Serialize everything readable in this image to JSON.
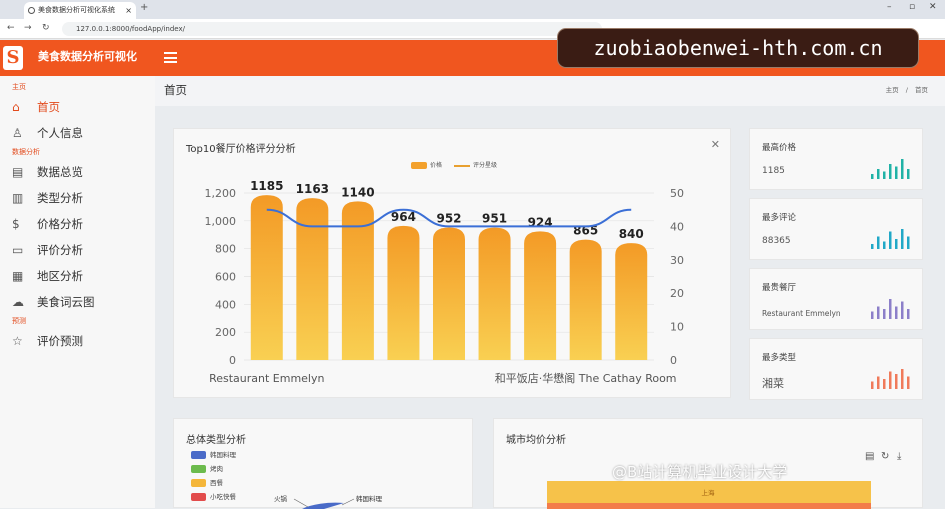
{
  "browser": {
    "tab_title": "美食数据分析可视化系统",
    "new_tab": "+",
    "url": "127.0.0.1:8000/foodApp/index/",
    "win_min": "–",
    "win_max": "▫",
    "win_close": "✕"
  },
  "header": {
    "logo": "S",
    "app_title": "美食数据分析可视化"
  },
  "watermark": "zuobiaobenwei-hth.com.cn",
  "sidebar": {
    "section_home": "主页",
    "section_analysis": "数据分析",
    "section_predict": "预测",
    "items": [
      {
        "label": "首页",
        "icon": "home-icon",
        "glyph": "⌂"
      },
      {
        "label": "个人信息",
        "icon": "user-icon",
        "glyph": "♙"
      },
      {
        "label": "数据总览",
        "icon": "table-icon",
        "glyph": "▤"
      },
      {
        "label": "类型分析",
        "icon": "bar-chart-icon",
        "glyph": "▥"
      },
      {
        "label": "价格分析",
        "icon": "dollar-icon",
        "glyph": "$"
      },
      {
        "label": "评价分析",
        "icon": "comment-icon",
        "glyph": "▭"
      },
      {
        "label": "地区分析",
        "icon": "map-icon",
        "glyph": "▦"
      },
      {
        "label": "美食词云图",
        "icon": "cloud-icon",
        "glyph": "☁"
      },
      {
        "label": "评价预测",
        "icon": "star-icon",
        "glyph": "☆"
      }
    ]
  },
  "page": {
    "title": "首页",
    "breadcrumb_home": "主页",
    "breadcrumb_sep": "/",
    "breadcrumb_current": "首页"
  },
  "main_chart": {
    "title": "Top10餐厅价格评分分析",
    "close": "✕",
    "legend_bar": "价格",
    "legend_line": "评分星级"
  },
  "chart_data": {
    "type": "bar",
    "title": "Top10餐厅价格评分分析",
    "categories": [
      "Restaurant Emmelyn",
      "",
      "",
      "",
      "",
      "",
      "",
      "和平饭店·华懋阁 The Cathay Room",
      ""
    ],
    "series": [
      {
        "name": "价格",
        "type": "bar",
        "values": [
          1185,
          1163,
          1140,
          964,
          952,
          951,
          924,
          865,
          840
        ]
      },
      {
        "name": "评分星级",
        "type": "line",
        "values": [
          45,
          40,
          40,
          45,
          40,
          40,
          40,
          40,
          45
        ]
      }
    ],
    "ylim_left": [
      0,
      1200
    ],
    "yticks_left": [
      "0",
      "200",
      "400",
      "600",
      "800",
      "1,000",
      "1,200"
    ],
    "ylim_right": [
      0,
      50
    ],
    "yticks_right": [
      "0",
      "10",
      "20",
      "30",
      "40",
      "50"
    ],
    "grid": true,
    "legend": "top-center",
    "colors": {
      "bar_top": "#f39a26",
      "bar_bottom": "#f9d052",
      "line": "#3b6fd6"
    }
  },
  "stats": [
    {
      "label": "最高价格",
      "value": "1185",
      "color": "#20b2a6",
      "spark": [
        2,
        4,
        3,
        6,
        5,
        8,
        4
      ]
    },
    {
      "label": "最多评论",
      "value": "88365",
      "color": "#21a8c7",
      "spark": [
        2,
        5,
        3,
        7,
        4,
        8,
        5
      ]
    },
    {
      "label": "最贵餐厅",
      "value": "Restaurant Emmelyn",
      "color": "#8c7fc9",
      "spark": [
        3,
        5,
        4,
        8,
        5,
        7,
        4
      ]
    },
    {
      "label": "最多类型",
      "value": "湘菜",
      "color": "#f07a5a",
      "spark": [
        3,
        5,
        4,
        7,
        6,
        8,
        5
      ]
    }
  ],
  "type_card": {
    "title": "总体类型分析",
    "legend": [
      {
        "label": "韩国料理",
        "color": "#4a6bc8"
      },
      {
        "label": "烤肉",
        "color": "#6cbb4d"
      },
      {
        "label": "西餐",
        "color": "#f4b63a"
      },
      {
        "label": "小吃快餐",
        "color": "#e24c4c"
      }
    ],
    "pie_label_left": "火锅",
    "pie_label_right": "韩国料理"
  },
  "city_card": {
    "title": "城市均价分析",
    "bar_label": "上海",
    "tool_doc": "▤",
    "tool_refresh": "↻",
    "tool_download": "⤓"
  },
  "bili_watermark": "@B站计算机毕业设计大学"
}
